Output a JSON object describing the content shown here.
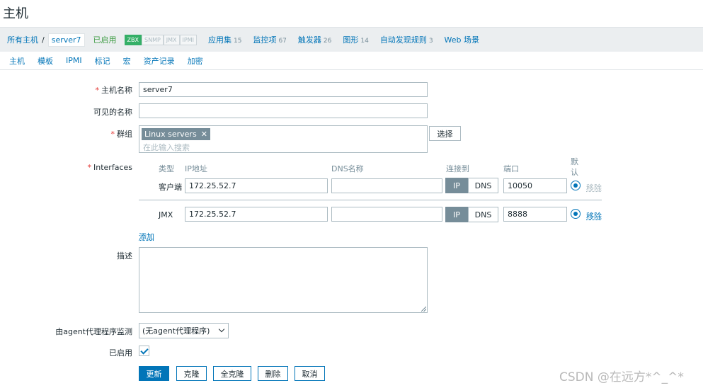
{
  "page": {
    "title": "主机"
  },
  "breadcrumb": {
    "all_hosts": "所有主机",
    "separator": "/",
    "current": "server7",
    "status": "已启用",
    "availability": [
      {
        "label": "ZBX",
        "active": true
      },
      {
        "label": "SNMP",
        "active": false
      },
      {
        "label": "JMX",
        "active": false
      },
      {
        "label": "IPMI",
        "active": false
      }
    ],
    "tabs": [
      {
        "label": "应用集",
        "count": "15"
      },
      {
        "label": "监控项",
        "count": "67"
      },
      {
        "label": "触发器",
        "count": "26"
      },
      {
        "label": "图形",
        "count": "14"
      },
      {
        "label": "自动发现规则",
        "count": "3"
      },
      {
        "label": "Web 场景",
        "count": ""
      }
    ]
  },
  "form_tabs": [
    "主机",
    "模板",
    "IPMI",
    "标记",
    "宏",
    "资产记录",
    "加密"
  ],
  "form": {
    "required_mark": "*",
    "host_name": {
      "label": "主机名称",
      "value": "server7"
    },
    "visible_name": {
      "label": "可见的名称",
      "value": ""
    },
    "groups": {
      "label": "群组",
      "chip": "Linux servers",
      "placeholder": "在此输入搜索",
      "select_label": "选择"
    },
    "interfaces": {
      "label": "Interfaces",
      "headers": {
        "type": "类型",
        "ip": "IP地址",
        "dns": "DNS名称",
        "connect": "连接到",
        "port": "端口",
        "default": "默\n认"
      },
      "rows": [
        {
          "type": "客户端",
          "ip": "172.25.52.7",
          "dns": "",
          "connect_ip": "IP",
          "connect_dns": "DNS",
          "port": "10050",
          "remove": "移除",
          "remove_enabled": false
        },
        {
          "type": "JMX",
          "ip": "172.25.52.7",
          "dns": "",
          "connect_ip": "IP",
          "connect_dns": "DNS",
          "port": "8888",
          "remove": "移除",
          "remove_enabled": true
        }
      ],
      "add_label": "添加"
    },
    "description": {
      "label": "描述",
      "value": ""
    },
    "proxy": {
      "label": "由agent代理程序监测",
      "value": "(无agent代理程序)"
    },
    "enabled": {
      "label": "已启用",
      "checked": true
    },
    "buttons": {
      "update": "更新",
      "clone": "克隆",
      "full_clone": "全克隆",
      "delete": "删除",
      "cancel": "取消"
    }
  },
  "watermark": "CSDN @在远方*^_^*"
}
